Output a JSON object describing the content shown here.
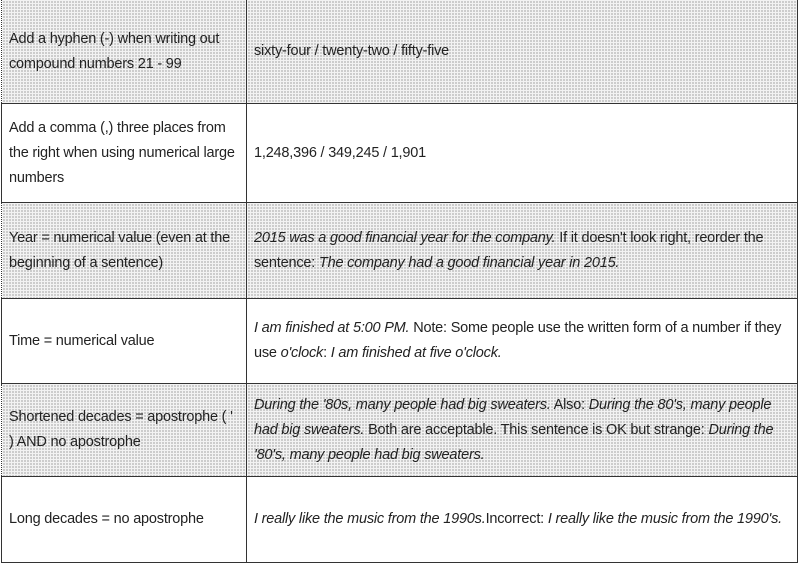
{
  "rows": [
    {
      "shaded": true,
      "rule": "Add a hyphen (-) when writing out compound numbers 21 - 99",
      "example": [
        {
          "text": "sixty-four / twenty-two / fifty-five",
          "italic": false
        }
      ]
    },
    {
      "shaded": false,
      "rule": "Add a comma (,) three places from the right when using numerical large numbers",
      "example": [
        {
          "text": "1,248,396 / 349,245 / 1,901",
          "italic": false
        }
      ]
    },
    {
      "shaded": true,
      "rule": "Year = numerical value (even at the beginning of a sentence)",
      "example": [
        {
          "text": "2015 was a good financial year for the company.",
          "italic": true
        },
        {
          "text": " If it doesn't look right, reorder the sentence: ",
          "italic": false
        },
        {
          "text": "The company had a good financial year in 2015.",
          "italic": true
        }
      ]
    },
    {
      "shaded": false,
      "rule": "Time = numerical value",
      "example": [
        {
          "text": "I am finished at 5:00 PM.",
          "italic": true
        },
        {
          "text": " Note: Some people use the written form of a number if they use ",
          "italic": false
        },
        {
          "text": "o'clock",
          "italic": true
        },
        {
          "text": ": ",
          "italic": false
        },
        {
          "text": "I am finished at five o'clock.",
          "italic": true
        }
      ]
    },
    {
      "shaded": true,
      "rule": "Shortened decades = apostrophe ( ' ) AND no apostrophe",
      "example": [
        {
          "text": "During the '80s, many people had big sweaters.",
          "italic": true
        },
        {
          "text": " Also: ",
          "italic": false
        },
        {
          "text": "During the 80's, many people had big sweaters.",
          "italic": true
        },
        {
          "text": " Both are acceptable. This sentence is OK but strange: ",
          "italic": false
        },
        {
          "text": "During the '80's, many people had big sweaters.",
          "italic": true
        }
      ]
    },
    {
      "shaded": false,
      "rule": "Long decades = no apostrophe",
      "example": [
        {
          "text": "I really like the music from the 1990s.",
          "italic": true
        },
        {
          "text": "Incorrect: ",
          "italic": false
        },
        {
          "text": "I really like the music from the 1990's.",
          "italic": true
        }
      ]
    }
  ]
}
